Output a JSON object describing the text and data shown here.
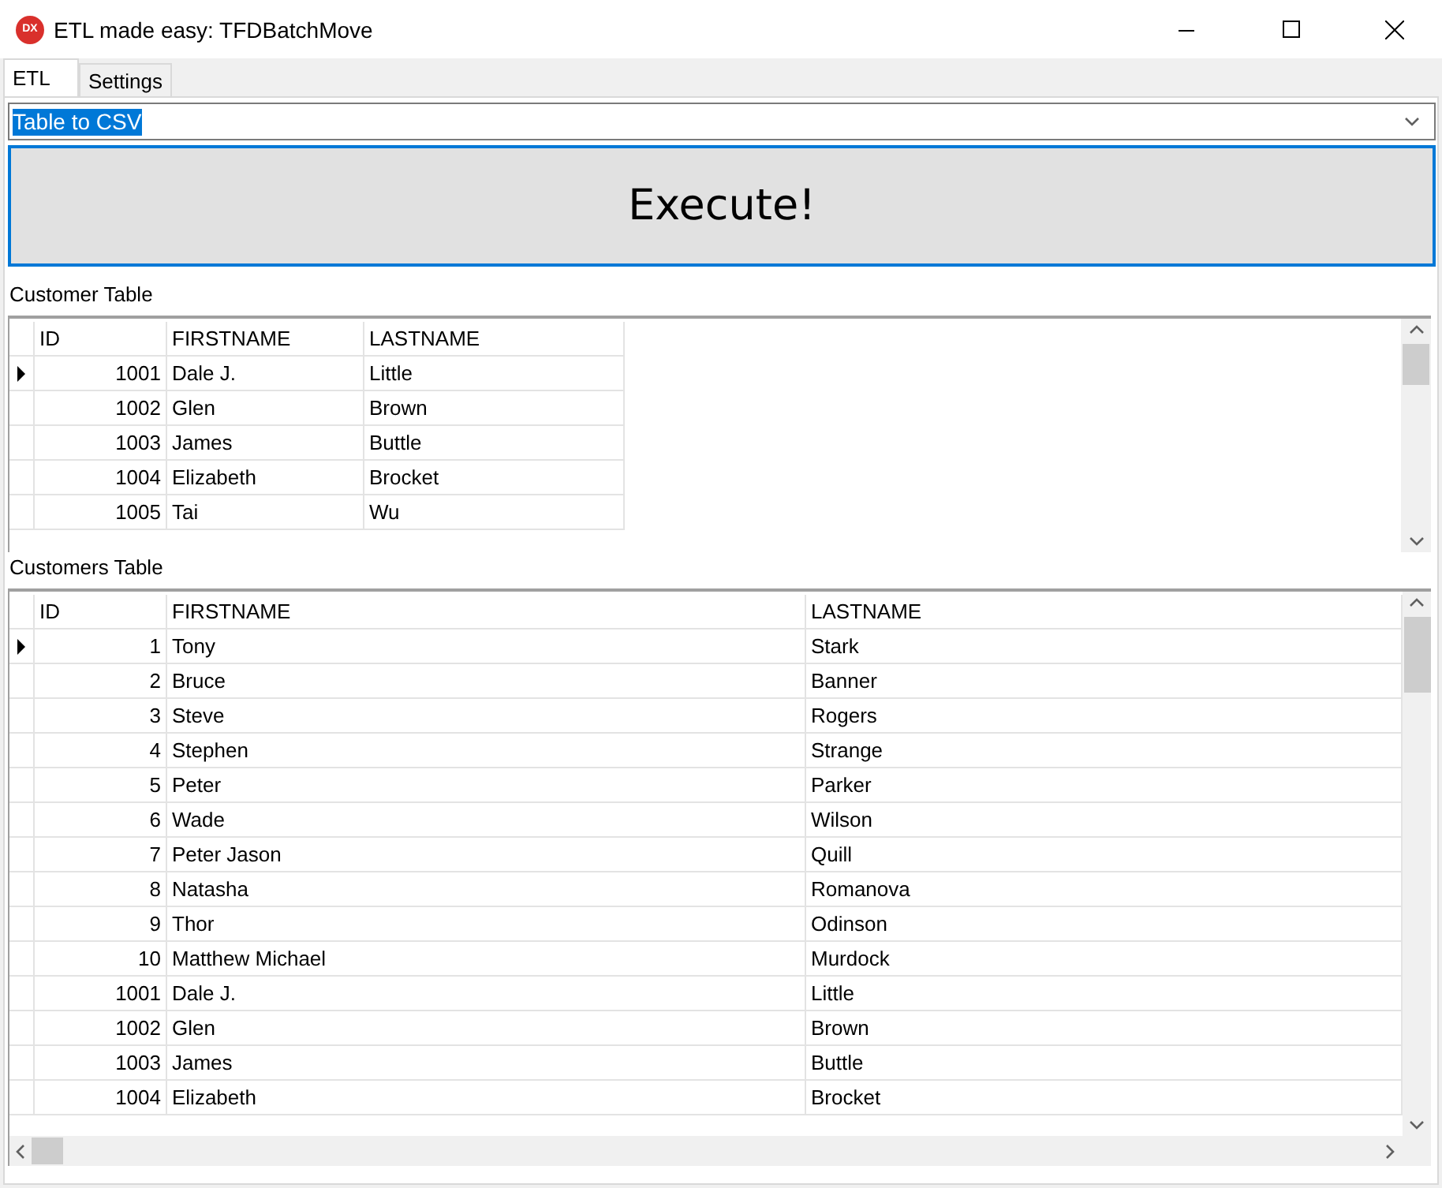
{
  "window": {
    "title": "ETL made easy: TFDBatchMove",
    "app_icon": "DX"
  },
  "tabs": [
    {
      "label": "ETL",
      "selected": true
    },
    {
      "label": "Settings",
      "selected": false
    }
  ],
  "mode_select": {
    "value": "Table to CSV"
  },
  "execute_button": "Execute!",
  "grids": [
    {
      "label": "Customer Table",
      "columns": [
        "ID",
        "FIRSTNAME",
        "LASTNAME"
      ],
      "horizontal_scroll": false,
      "rows": [
        {
          "cells": [
            "1001",
            "Dale J.",
            "Little"
          ],
          "selected": true
        },
        {
          "cells": [
            "1002",
            "Glen",
            "Brown"
          ],
          "selected": false
        },
        {
          "cells": [
            "1003",
            "James",
            "Buttle"
          ],
          "selected": false
        },
        {
          "cells": [
            "1004",
            "Elizabeth",
            "Brocket"
          ],
          "selected": false
        },
        {
          "cells": [
            "1005",
            "Tai",
            "Wu"
          ],
          "selected": false
        }
      ]
    },
    {
      "label": "Customers Table",
      "columns": [
        "ID",
        "FIRSTNAME",
        "LASTNAME"
      ],
      "horizontal_scroll": true,
      "rows": [
        {
          "cells": [
            "1",
            "Tony",
            "Stark"
          ],
          "selected": true
        },
        {
          "cells": [
            "2",
            "Bruce",
            "Banner"
          ],
          "selected": false
        },
        {
          "cells": [
            "3",
            "Steve",
            "Rogers"
          ],
          "selected": false
        },
        {
          "cells": [
            "4",
            "Stephen",
            "Strange"
          ],
          "selected": false
        },
        {
          "cells": [
            "5",
            "Peter",
            "Parker"
          ],
          "selected": false
        },
        {
          "cells": [
            "6",
            "Wade",
            "Wilson"
          ],
          "selected": false
        },
        {
          "cells": [
            "7",
            "Peter Jason",
            "Quill"
          ],
          "selected": false
        },
        {
          "cells": [
            "8",
            "Natasha",
            "Romanova"
          ],
          "selected": false
        },
        {
          "cells": [
            "9",
            "Thor",
            "Odinson"
          ],
          "selected": false
        },
        {
          "cells": [
            "10",
            "Matthew Michael",
            "Murdock"
          ],
          "selected": false
        },
        {
          "cells": [
            "1001",
            "Dale J.",
            "Little"
          ],
          "selected": false
        },
        {
          "cells": [
            "1002",
            "Glen",
            "Brown"
          ],
          "selected": false
        },
        {
          "cells": [
            "1003",
            "James",
            "Buttle"
          ],
          "selected": false
        },
        {
          "cells": [
            "1004",
            "Elizabeth",
            "Brocket"
          ],
          "selected": false
        }
      ]
    }
  ]
}
